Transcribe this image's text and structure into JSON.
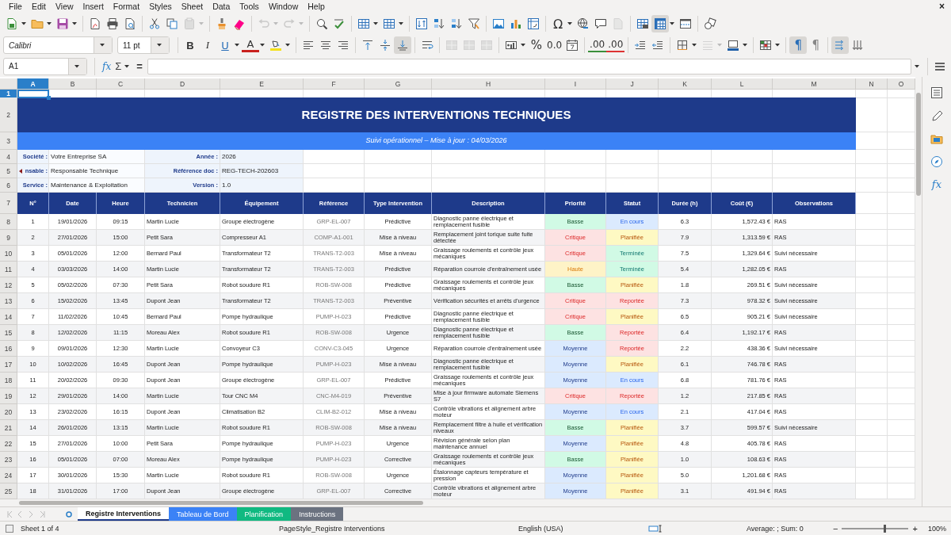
{
  "menu": [
    "File",
    "Edit",
    "View",
    "Insert",
    "Format",
    "Styles",
    "Sheet",
    "Data",
    "Tools",
    "Window",
    "Help"
  ],
  "close_glyph": "×",
  "toolbar_1": [
    {
      "kind": "new",
      "dropdown": true,
      "disabled": false,
      "on": false
    },
    {
      "kind": "open",
      "dropdown": true,
      "disabled": false,
      "on": false
    },
    {
      "kind": "save",
      "dropdown": true,
      "disabled": false,
      "on": false
    },
    {
      "kind": "sep"
    },
    {
      "kind": "pdf",
      "disabled": false,
      "on": false
    },
    {
      "kind": "print",
      "disabled": false,
      "on": false
    },
    {
      "kind": "preview",
      "disabled": false,
      "on": false
    },
    {
      "kind": "sep"
    },
    {
      "kind": "cut",
      "disabled": false,
      "on": false
    },
    {
      "kind": "copy",
      "disabled": false,
      "on": false
    },
    {
      "kind": "paste",
      "dropdown": true,
      "disabled": true,
      "on": false
    },
    {
      "kind": "sep"
    },
    {
      "kind": "clone",
      "disabled": false,
      "on": false
    },
    {
      "kind": "clear",
      "disabled": false,
      "on": false
    },
    {
      "kind": "sep"
    },
    {
      "kind": "undo",
      "dropdown": true,
      "disabled": true,
      "on": false
    },
    {
      "kind": "redo",
      "dropdown": true,
      "disabled": true,
      "on": false
    },
    {
      "kind": "sep"
    },
    {
      "kind": "find",
      "disabled": false,
      "on": false
    },
    {
      "kind": "spell",
      "disabled": false,
      "on": false
    },
    {
      "kind": "sep"
    },
    {
      "kind": "rows",
      "dropdown": true,
      "disabled": false,
      "on": false
    },
    {
      "kind": "cols",
      "dropdown": true,
      "disabled": false,
      "on": false
    },
    {
      "kind": "sep"
    },
    {
      "kind": "sort",
      "disabled": false,
      "on": false
    },
    {
      "kind": "sortasc",
      "disabled": false,
      "on": false
    },
    {
      "kind": "sortdesc",
      "disabled": false,
      "on": false
    },
    {
      "kind": "filter",
      "disabled": false,
      "on": false
    },
    {
      "kind": "sep"
    },
    {
      "kind": "image",
      "disabled": false,
      "on": false
    },
    {
      "kind": "chart",
      "disabled": false,
      "on": false
    },
    {
      "kind": "pivot",
      "disabled": false,
      "on": false
    },
    {
      "kind": "sep"
    },
    {
      "kind": "special",
      "glyph": "Ω",
      "dropdown": true,
      "disabled": false,
      "on": false
    },
    {
      "kind": "link",
      "disabled": false,
      "on": false
    },
    {
      "kind": "comment",
      "disabled": false,
      "on": false
    },
    {
      "kind": "headers",
      "disabled": true,
      "on": false
    },
    {
      "kind": "sep"
    },
    {
      "kind": "printarea",
      "disabled": false,
      "on": false
    },
    {
      "kind": "freeze",
      "dropdown": true,
      "disabled": false,
      "on": true
    },
    {
      "kind": "split",
      "disabled": false,
      "on": false
    },
    {
      "kind": "sep"
    },
    {
      "kind": "shapes",
      "disabled": false,
      "on": false
    }
  ],
  "font_name": "Calibri",
  "font_size": "11 pt",
  "toolbar_2": [
    {
      "kind": "bold",
      "glyph": "B",
      "disabled": false,
      "on": false
    },
    {
      "kind": "italic",
      "glyph": "I",
      "disabled": false,
      "on": false
    },
    {
      "kind": "underline",
      "glyph": "U",
      "dropdown": true,
      "disabled": false,
      "on": false
    },
    {
      "kind": "fontcolor",
      "glyph": "A",
      "dropdown": true,
      "disabled": false,
      "on": false
    },
    {
      "kind": "highlight",
      "dropdown": true,
      "disabled": false,
      "on": false
    },
    {
      "kind": "sep"
    },
    {
      "kind": "alignleft",
      "disabled": false,
      "on": false
    },
    {
      "kind": "aligncenter",
      "disabled": false,
      "on": false
    },
    {
      "kind": "alignright",
      "disabled": false,
      "on": false
    },
    {
      "kind": "sep"
    },
    {
      "kind": "valigntop",
      "disabled": false,
      "on": false
    },
    {
      "kind": "valignmiddle",
      "disabled": false,
      "on": false
    },
    {
      "kind": "valignbottom",
      "disabled": false,
      "on": true
    },
    {
      "kind": "sep"
    },
    {
      "kind": "wrap",
      "disabled": false,
      "on": false
    },
    {
      "kind": "sep"
    },
    {
      "kind": "merge",
      "disabled": true,
      "on": false
    },
    {
      "kind": "merge",
      "disabled": true,
      "on": false
    },
    {
      "kind": "merge",
      "disabled": true,
      "on": false
    },
    {
      "kind": "sep"
    },
    {
      "kind": "numformat",
      "dropdown": true,
      "disabled": false,
      "on": false
    },
    {
      "kind": "percent",
      "glyph": "%",
      "disabled": false,
      "on": false
    },
    {
      "kind": "number",
      "glyph": "0.0",
      "disabled": false,
      "on": false
    },
    {
      "kind": "date",
      "disabled": false,
      "on": false
    },
    {
      "kind": "sep"
    },
    {
      "kind": "adddecimal",
      "glyph": ".00",
      "disabled": false,
      "on": false
    },
    {
      "kind": "deldecimal",
      "glyph": ".00",
      "disabled": false,
      "on": false
    },
    {
      "kind": "sep"
    },
    {
      "kind": "indentinc",
      "disabled": false,
      "on": false
    },
    {
      "kind": "indentdec",
      "disabled": false,
      "on": false
    },
    {
      "kind": "sep"
    },
    {
      "kind": "borders",
      "dropdown": true,
      "disabled": false,
      "on": false
    },
    {
      "kind": "borderstyle",
      "dropdown": true,
      "disabled": true,
      "on": false
    },
    {
      "kind": "bordercolor",
      "dropdown": true,
      "disabled": false,
      "on": false
    },
    {
      "kind": "sep"
    },
    {
      "kind": "conditional",
      "dropdown": true,
      "disabled": false,
      "on": false
    },
    {
      "kind": "sep"
    },
    {
      "kind": "ltr",
      "glyph": "¶",
      "disabled": false,
      "on": true
    },
    {
      "kind": "rtl",
      "glyph": "¶",
      "disabled": false,
      "on": false
    },
    {
      "kind": "sep"
    },
    {
      "kind": "textltr",
      "disabled": false,
      "on": true
    },
    {
      "kind": "texttb",
      "disabled": false,
      "on": false
    }
  ],
  "formula_bar": {
    "cell_ref": "A1",
    "function_glyph": "fx",
    "sum_glyph": "Σ",
    "equals_glyph": "="
  },
  "column_headers": [
    {
      "label": "A",
      "selected": true
    },
    {
      "label": "B",
      "selected": false
    },
    {
      "label": "C",
      "selected": false
    },
    {
      "label": "D",
      "selected": false
    },
    {
      "label": "E",
      "selected": false
    },
    {
      "label": "F",
      "selected": false
    },
    {
      "label": "G",
      "selected": false
    },
    {
      "label": "H",
      "selected": false
    },
    {
      "label": "I",
      "selected": false
    },
    {
      "label": "J",
      "selected": false
    },
    {
      "label": "K",
      "selected": false
    },
    {
      "label": "L",
      "selected": false
    },
    {
      "label": "M",
      "selected": false
    },
    {
      "label": "N",
      "selected": false
    },
    {
      "label": "O",
      "selected": false
    }
  ],
  "row_numbers": [
    {
      "label": "1",
      "selected": true
    },
    {
      "label": "2",
      "selected": false
    },
    {
      "label": "3",
      "selected": false
    },
    {
      "label": "4",
      "selected": false
    },
    {
      "label": "5",
      "selected": false
    },
    {
      "label": "6",
      "selected": false
    },
    {
      "label": "7",
      "selected": false
    },
    {
      "label": "8",
      "selected": false
    },
    {
      "label": "9",
      "selected": false
    },
    {
      "label": "10",
      "selected": false
    },
    {
      "label": "11",
      "selected": false
    },
    {
      "label": "12",
      "selected": false
    },
    {
      "label": "13",
      "selected": false
    },
    {
      "label": "14",
      "selected": false
    },
    {
      "label": "15",
      "selected": false
    },
    {
      "label": "16",
      "selected": false
    },
    {
      "label": "17",
      "selected": false
    },
    {
      "label": "18",
      "selected": false
    },
    {
      "label": "19",
      "selected": false
    },
    {
      "label": "20",
      "selected": false
    },
    {
      "label": "21",
      "selected": false
    },
    {
      "label": "22",
      "selected": false
    },
    {
      "label": "23",
      "selected": false
    },
    {
      "label": "24",
      "selected": false
    },
    {
      "label": "25",
      "selected": false
    }
  ],
  "sheet": {
    "title": "REGISTRE DES INTERVENTIONS TECHNIQUES",
    "subtitle": "Suivi opérationnel – Mise à jour : 04/03/2026",
    "info": [
      {
        "label": "Société :",
        "value": "Votre Entreprise SA",
        "label_2": "Année :",
        "value_2": "2026"
      },
      {
        "label": "nsable :",
        "value": "Responsable Technique",
        "clipped": true,
        "label_2": "Référence doc :",
        "value_2": "REG-TECH-202603"
      },
      {
        "label": "Service :",
        "value": "Maintenance & Exploitation",
        "label_2": "Version :",
        "value_2": "1.0"
      }
    ],
    "columns": [
      "N°",
      "Date",
      "Heure",
      "Technicien",
      "Équipement",
      "Référence",
      "Type Intervention",
      "Description",
      "Priorité",
      "Statut",
      "Durée (h)",
      "Coût (€)",
      "Observations"
    ],
    "rows": [
      {
        "n": "1",
        "date": "19/01/2026",
        "time": "09:15",
        "technician": "Martin Lucie",
        "equipment": "Groupe électrogène",
        "reference": "GRP-EL-007",
        "type": "Prédictive",
        "description": "Diagnostic panne électrique et remplacement fusible",
        "priority": {
          "text": "Basse",
          "color": "#d1fae5"
        },
        "status": {
          "text": "En cours",
          "color": "#dbeafe"
        },
        "duration": "6.3",
        "cost": "1,572.43 €",
        "notes": "RAS"
      },
      {
        "n": "2",
        "date": "27/01/2026",
        "time": "15:00",
        "technician": "Petit Sara",
        "equipment": "Compresseur A1",
        "reference": "COMP-A1-001",
        "type": "Mise à niveau",
        "description": "Remplacement joint torique suite fuite détectée",
        "priority": {
          "text": "Critique",
          "color": "#fde2e2"
        },
        "status": {
          "text": "Planifiée",
          "color": "#fef9c3"
        },
        "duration": "7.9",
        "cost": "1,313.59 €",
        "notes": "RAS"
      },
      {
        "n": "3",
        "date": "05/01/2026",
        "time": "12:00",
        "technician": "Bernard Paul",
        "equipment": "Transformateur T2",
        "reference": "TRANS-T2-003",
        "type": "Mise à niveau",
        "description": "Graissage roulements et contrôle jeux mécaniques",
        "priority": {
          "text": "Critique",
          "color": "#fde2e2"
        },
        "status": {
          "text": "Terminée",
          "color": "#d1fae5"
        },
        "duration": "7.5",
        "cost": "1,329.64 €",
        "notes": "Suivi nécessaire"
      },
      {
        "n": "4",
        "date": "03/03/2026",
        "time": "14:00",
        "technician": "Martin Lucie",
        "equipment": "Transformateur T2",
        "reference": "TRANS-T2-003",
        "type": "Prédictive",
        "description": "Réparation courroie d'entraînement usée",
        "priority": {
          "text": "Haute",
          "color": "#fef3c7"
        },
        "status": {
          "text": "Terminée",
          "color": "#d1fae5"
        },
        "duration": "5.4",
        "cost": "1,282.05 €",
        "notes": "RAS"
      },
      {
        "n": "5",
        "date": "05/02/2026",
        "time": "07:30",
        "technician": "Petit Sara",
        "equipment": "Robot soudure R1",
        "reference": "ROB-SW-008",
        "type": "Prédictive",
        "description": "Graissage roulements et contrôle jeux mécaniques",
        "priority": {
          "text": "Basse",
          "color": "#d1fae5"
        },
        "status": {
          "text": "Planifiée",
          "color": "#fef9c3"
        },
        "duration": "1.8",
        "cost": "269.51 €",
        "notes": "Suivi nécessaire"
      },
      {
        "n": "6",
        "date": "15/02/2026",
        "time": "13:45",
        "technician": "Dupont Jean",
        "equipment": "Transformateur T2",
        "reference": "TRANS-T2-003",
        "type": "Préventive",
        "description": "Vérification sécurités et arrêts d'urgence",
        "priority": {
          "text": "Critique",
          "color": "#fde2e2"
        },
        "status": {
          "text": "Reportée",
          "color": "#fde2e2"
        },
        "duration": "7.3",
        "cost": "978.32 €",
        "notes": "Suivi nécessaire"
      },
      {
        "n": "7",
        "date": "11/02/2026",
        "time": "10:45",
        "technician": "Bernard Paul",
        "equipment": "Pompe hydraulique",
        "reference": "PUMP-H-023",
        "type": "Prédictive",
        "description": "Diagnostic panne électrique et remplacement fusible",
        "priority": {
          "text": "Critique",
          "color": "#fde2e2"
        },
        "status": {
          "text": "Planifiée",
          "color": "#fef9c3"
        },
        "duration": "6.5",
        "cost": "905.21 €",
        "notes": "Suivi nécessaire"
      },
      {
        "n": "8",
        "date": "12/02/2026",
        "time": "11:15",
        "technician": "Moreau Alex",
        "equipment": "Robot soudure R1",
        "reference": "ROB-SW-008",
        "type": "Urgence",
        "description": "Diagnostic panne électrique et remplacement fusible",
        "priority": {
          "text": "Basse",
          "color": "#d1fae5"
        },
        "status": {
          "text": "Reportée",
          "color": "#fde2e2"
        },
        "duration": "6.4",
        "cost": "1,192.17 €",
        "notes": "RAS"
      },
      {
        "n": "9",
        "date": "09/01/2026",
        "time": "12:30",
        "technician": "Martin Lucie",
        "equipment": "Convoyeur C3",
        "reference": "CONV-C3-045",
        "type": "Urgence",
        "description": "Réparation courroie d'entraînement usée",
        "priority": {
          "text": "Moyenne",
          "color": "#dbeafe"
        },
        "status": {
          "text": "Reportée",
          "color": "#fde2e2"
        },
        "duration": "2.2",
        "cost": "438.36 €",
        "notes": "Suivi nécessaire"
      },
      {
        "n": "10",
        "date": "10/02/2026",
        "time": "16:45",
        "technician": "Dupont Jean",
        "equipment": "Pompe hydraulique",
        "reference": "PUMP-H-023",
        "type": "Mise à niveau",
        "description": "Diagnostic panne électrique et remplacement fusible",
        "priority": {
          "text": "Moyenne",
          "color": "#dbeafe"
        },
        "status": {
          "text": "Planifiée",
          "color": "#fef9c3"
        },
        "duration": "6.1",
        "cost": "746.78 €",
        "notes": "RAS"
      },
      {
        "n": "11",
        "date": "20/02/2026",
        "time": "09:30",
        "technician": "Dupont Jean",
        "equipment": "Groupe électrogène",
        "reference": "GRP-EL-007",
        "type": "Prédictive",
        "description": "Graissage roulements et contrôle jeux mécaniques",
        "priority": {
          "text": "Moyenne",
          "color": "#dbeafe"
        },
        "status": {
          "text": "En cours",
          "color": "#dbeafe"
        },
        "duration": "6.8",
        "cost": "781.76 €",
        "notes": "RAS"
      },
      {
        "n": "12",
        "date": "29/01/2026",
        "time": "14:00",
        "technician": "Martin Lucie",
        "equipment": "Tour CNC M4",
        "reference": "CNC-M4-019",
        "type": "Préventive",
        "description": "Mise à jour firmware automate Siemens S7",
        "priority": {
          "text": "Critique",
          "color": "#fde2e2"
        },
        "status": {
          "text": "Reportée",
          "color": "#fde2e2"
        },
        "duration": "1.2",
        "cost": "217.85 €",
        "notes": "RAS"
      },
      {
        "n": "13",
        "date": "23/02/2026",
        "time": "16:15",
        "technician": "Dupont Jean",
        "equipment": "Climatisation B2",
        "reference": "CLIM-B2-012",
        "type": "Mise à niveau",
        "description": "Contrôle vibrations et alignement arbre moteur",
        "priority": {
          "text": "Moyenne",
          "color": "#dbeafe"
        },
        "status": {
          "text": "En cours",
          "color": "#dbeafe"
        },
        "duration": "2.1",
        "cost": "417.04 €",
        "notes": "RAS"
      },
      {
        "n": "14",
        "date": "26/01/2026",
        "time": "13:15",
        "technician": "Martin Lucie",
        "equipment": "Robot soudure R1",
        "reference": "ROB-SW-008",
        "type": "Mise à niveau",
        "description": "Remplacement filtre à huile et vérification niveaux",
        "priority": {
          "text": "Basse",
          "color": "#d1fae5"
        },
        "status": {
          "text": "Planifiée",
          "color": "#fef9c3"
        },
        "duration": "3.7",
        "cost": "599.57 €",
        "notes": "Suivi nécessaire"
      },
      {
        "n": "15",
        "date": "27/01/2026",
        "time": "10:00",
        "technician": "Petit Sara",
        "equipment": "Pompe hydraulique",
        "reference": "PUMP-H-023",
        "type": "Urgence",
        "description": "Révision générale selon plan maintenance annuel",
        "priority": {
          "text": "Moyenne",
          "color": "#dbeafe"
        },
        "status": {
          "text": "Planifiée",
          "color": "#fef9c3"
        },
        "duration": "4.8",
        "cost": "405.78 €",
        "notes": "RAS"
      },
      {
        "n": "16",
        "date": "05/01/2026",
        "time": "07:00",
        "technician": "Moreau Alex",
        "equipment": "Pompe hydraulique",
        "reference": "PUMP-H-023",
        "type": "Corrective",
        "description": "Graissage roulements et contrôle jeux mécaniques",
        "priority": {
          "text": "Basse",
          "color": "#d1fae5"
        },
        "status": {
          "text": "Planifiée",
          "color": "#fef9c3"
        },
        "duration": "1.0",
        "cost": "108.63 €",
        "notes": "RAS"
      },
      {
        "n": "17",
        "date": "30/01/2026",
        "time": "15:30",
        "technician": "Martin Lucie",
        "equipment": "Robot soudure R1",
        "reference": "ROB-SW-008",
        "type": "Urgence",
        "description": "Étalonnage capteurs température et pression",
        "priority": {
          "text": "Moyenne",
          "color": "#dbeafe"
        },
        "status": {
          "text": "Planifiée",
          "color": "#fef9c3"
        },
        "duration": "5.0",
        "cost": "1,201.68 €",
        "notes": "RAS"
      },
      {
        "n": "18",
        "date": "31/01/2026",
        "time": "17:00",
        "technician": "Dupont Jean",
        "equipment": "Groupe électrogène",
        "reference": "GRP-EL-007",
        "type": "Corrective",
        "description": "Contrôle vibrations et alignement arbre moteur",
        "priority": {
          "text": "Moyenne",
          "color": "#dbeafe"
        },
        "status": {
          "text": "Planifiée",
          "color": "#fef9c3"
        },
        "duration": "3.1",
        "cost": "491.94 €",
        "notes": "RAS"
      }
    ]
  },
  "sheet_tabs": [
    {
      "label": "Registre Interventions",
      "selected": true,
      "color": "#ffffff"
    },
    {
      "label": "Tableau de Bord",
      "selected": false,
      "color": "#3b82f6"
    },
    {
      "label": "Planification",
      "selected": false,
      "color": "#10b981"
    },
    {
      "label": "Instructions",
      "selected": false,
      "color": "#6b7280"
    }
  ],
  "status_bar": {
    "sheet": "Sheet 1 of 4",
    "page_style": "PageStyle_Registre Interventions",
    "language": "English (USA)",
    "summary": "Average: ; Sum: 0",
    "zoom_out": "−",
    "zoom_in": "+",
    "zoom_slider": {
      "level": 0.62
    },
    "zoom": "100%"
  },
  "sidebar": [
    {
      "kind": "properties"
    },
    {
      "kind": "styles"
    },
    {
      "kind": "gallery"
    },
    {
      "kind": "navigator"
    },
    {
      "kind": "functions",
      "glyph": "fx"
    }
  ]
}
